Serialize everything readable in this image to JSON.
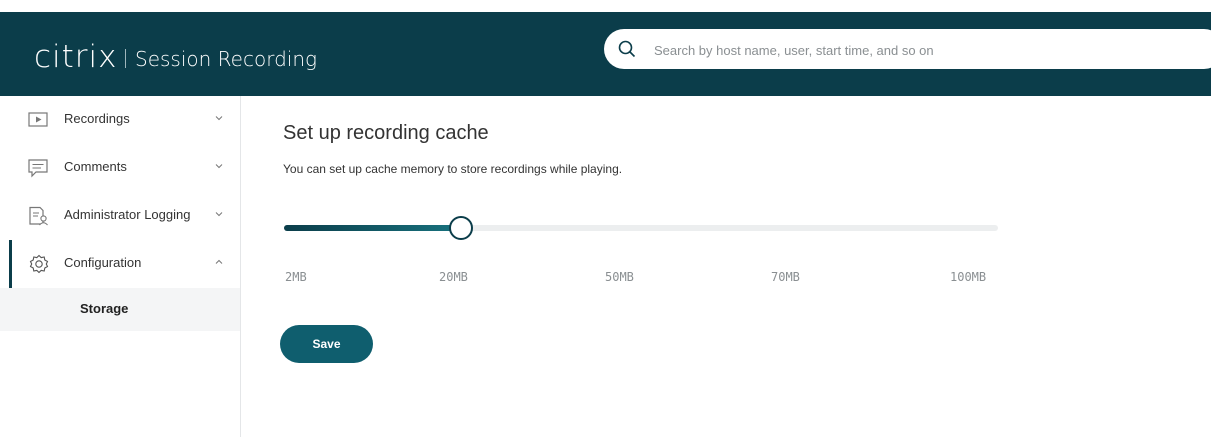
{
  "header": {
    "logo_text": "citrix",
    "product_name": "Session Recording",
    "search": {
      "placeholder": "Search by host name, user, start time, and so on",
      "value": ""
    }
  },
  "sidebar": {
    "items": [
      {
        "label": "Recordings",
        "icon": "play-icon",
        "expanded": false
      },
      {
        "label": "Comments",
        "icon": "comment-icon",
        "expanded": false
      },
      {
        "label": "Administrator Logging",
        "icon": "log-icon",
        "expanded": false
      },
      {
        "label": "Configuration",
        "icon": "gear-icon",
        "expanded": true,
        "active": true
      }
    ],
    "subitems": [
      {
        "label": "Storage",
        "selected": true
      }
    ]
  },
  "main": {
    "title": "Set up recording cache",
    "description": "You can set up cache memory to store recordings while playing.",
    "slider": {
      "ticks": [
        "2MB",
        "20MB",
        "50MB",
        "70MB",
        "100MB"
      ],
      "value": "20MB"
    },
    "save_label": "Save"
  },
  "colors": {
    "header_bg": "#0b3d4a",
    "accent": "#0f5e6e",
    "track": "#eceeef"
  }
}
